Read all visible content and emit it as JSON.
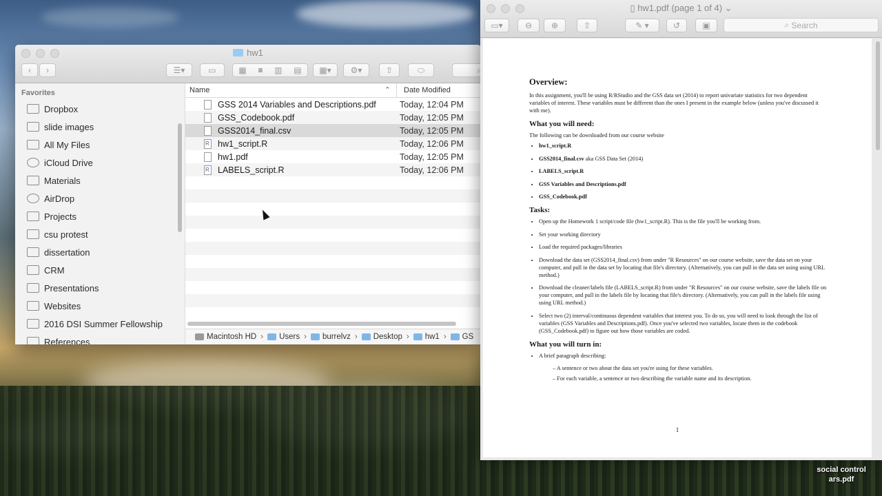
{
  "finder": {
    "title": "hw1",
    "sidebar_header": "Favorites",
    "sidebar_items": [
      {
        "label": "Dropbox",
        "icon": "dropbox-icon"
      },
      {
        "label": "slide images",
        "icon": "folder-icon"
      },
      {
        "label": "All My Files",
        "icon": "all-files-icon"
      },
      {
        "label": "iCloud Drive",
        "icon": "cloud-icon"
      },
      {
        "label": "Materials",
        "icon": "folder-icon"
      },
      {
        "label": "AirDrop",
        "icon": "airdrop-icon"
      },
      {
        "label": "Projects",
        "icon": "folder-icon"
      },
      {
        "label": "csu protest",
        "icon": "folder-icon"
      },
      {
        "label": "dissertation",
        "icon": "folder-icon"
      },
      {
        "label": "CRM",
        "icon": "folder-icon"
      },
      {
        "label": "Presentations",
        "icon": "folder-icon"
      },
      {
        "label": "Websites",
        "icon": "folder-icon"
      },
      {
        "label": "2016 DSI Summer Fellowship",
        "icon": "folder-icon"
      },
      {
        "label": "References",
        "icon": "folder-icon"
      }
    ],
    "columns": {
      "name": "Name",
      "date": "Date Modified"
    },
    "files": [
      {
        "name": "GSS 2014 Variables and Descriptions.pdf",
        "date": "Today, 12:04 PM",
        "type": "pdf"
      },
      {
        "name": "GSS_Codebook.pdf",
        "date": "Today, 12:05 PM",
        "type": "pdf"
      },
      {
        "name": "GSS2014_final.csv",
        "date": "Today, 12:05 PM",
        "type": "csv"
      },
      {
        "name": "hw1_script.R",
        "date": "Today, 12:06 PM",
        "type": "r"
      },
      {
        "name": "hw1.pdf",
        "date": "Today, 12:05 PM",
        "type": "pdf"
      },
      {
        "name": "LABELS_script.R",
        "date": "Today, 12:06 PM",
        "type": "r"
      }
    ],
    "path": [
      "Macintosh HD",
      "Users",
      "burrelvz",
      "Desktop",
      "hw1",
      "GS"
    ]
  },
  "preview": {
    "title": "hw1.pdf (page 1 of 4)",
    "search_placeholder": "Search",
    "doc": {
      "overview_heading": "Overview:",
      "overview_text": "In this assignment, you'll be using R/RStudio and the GSS data set (2014) to report univariate statistics for two dependent variables of interest. These variables must be different than the ones I present in the example below (unless you've discussed it with me).",
      "need_heading": "What you will need:",
      "need_text": "The following can be downloaded from our course website",
      "need_items": [
        "hw1_script.R",
        "GSS2014_final.csv",
        "LABELS_script.R",
        "GSS Variables and Descriptions.pdf",
        "GSS_Codebook.pdf"
      ],
      "need_suffix": " aka GSS Data Set (2014)",
      "tasks_heading": "Tasks:",
      "tasks": [
        "Open up the Homework 1 script/code file (hw1_script.R). This is the file you'll be working from.",
        "Set your working directory",
        "Load the required packages/libraries",
        "Download the data set (GSS2014_final.csv) from under \"R Resources\" on our course website, save the data set on your computer, and pull in the data set by locating that file's directory. (Alternatively, you can pull in the data set using using URL method.)",
        "Download the cleaner/labels file (LABELS_script.R) from under \"R Resources\" on our course website, save the labels file on your computer, and pull in the labels file by locating that file's directory. (Alternatively, you can pull in the labels file using using URL method.)",
        "Select two (2) interval/continuous dependent variables that interest you. To do so, you will need to look through the list of variables (GSS Variables and Descriptions.pdf). Once you've selected two variables, locate them in the codebook (GSS_Codebook.pdf) to figure out how those variables are coded."
      ],
      "turnin_heading": "What you will turn in:",
      "turnin_item": "A brief paragraph describing:",
      "turnin_sub": [
        "A sentence or two about the data set you're using for these variables.",
        "For each variable, a sentence or two describing the variable name and its description."
      ],
      "page_number": "1"
    }
  },
  "desktop_file": {
    "line1": "social control",
    "line2": "ars.pdf"
  }
}
